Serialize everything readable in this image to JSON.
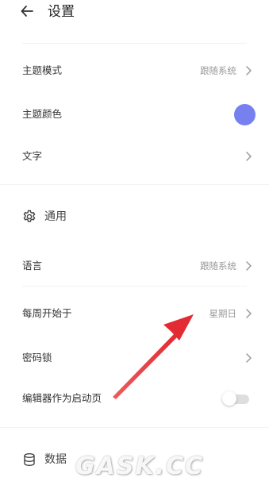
{
  "header": {
    "title": "设置"
  },
  "appearance": {
    "theme_mode": {
      "label": "主题模式",
      "value": "跟随系统"
    },
    "theme_color": {
      "label": "主题颜色",
      "color": "#7681ef"
    },
    "text": {
      "label": "文字"
    }
  },
  "general": {
    "section_label": "通用",
    "language": {
      "label": "语言",
      "value": "跟随系统"
    },
    "week_start": {
      "label": "每周开始于",
      "value": "星期日"
    },
    "password_lock": {
      "label": "密码锁"
    },
    "editor_startup": {
      "label": "编辑器作为启动页",
      "enabled": false
    }
  },
  "data_section": {
    "section_label": "数据"
  },
  "overlay": {
    "arrow_color": "#e8323a",
    "watermark": "GASK.CC"
  }
}
